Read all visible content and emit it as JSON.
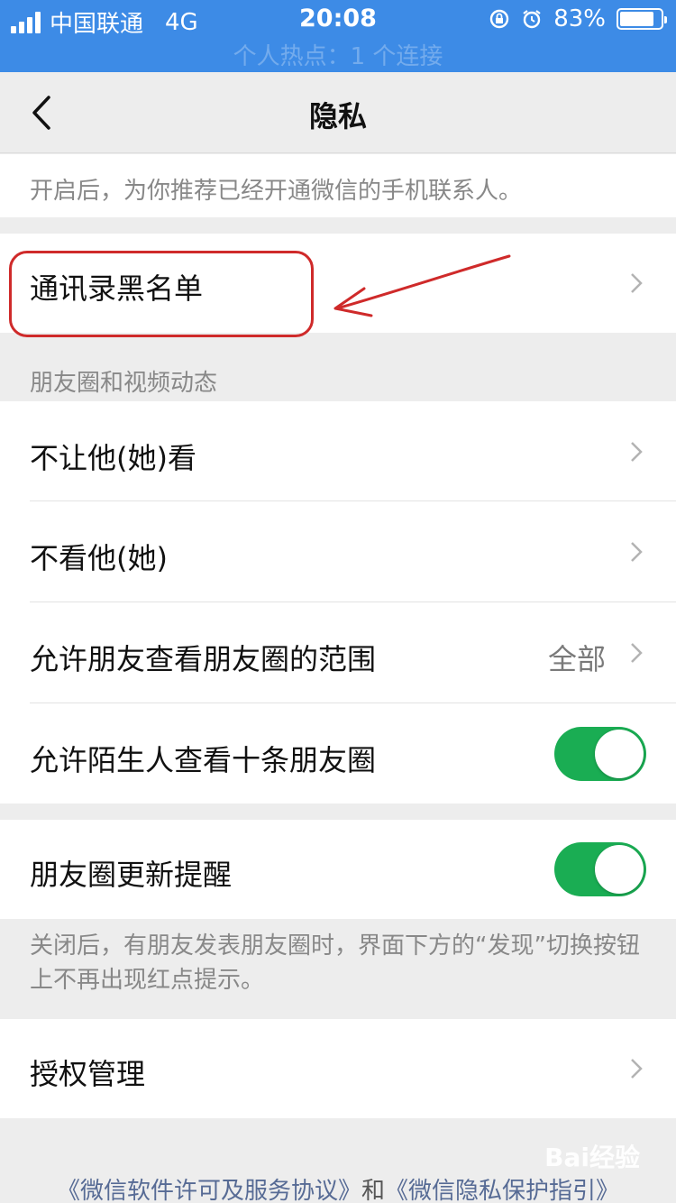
{
  "status_bar": {
    "carrier": "中国联通",
    "network": "4G",
    "time": "20:08",
    "battery": "83%",
    "battery_level": 0.83,
    "hotspot": "个人热点：1 个连接"
  },
  "nav": {
    "title": "隐私"
  },
  "top_desc": "开启后，为你推荐已经开通微信的手机联系人。",
  "blacklist": {
    "label": "通讯录黑名单"
  },
  "moments_section": {
    "header": "朋友圈和视频动态",
    "items": [
      {
        "label": "不让他(她)看"
      },
      {
        "label": "不看他(她)"
      },
      {
        "label": "允许朋友查看朋友圈的范围",
        "value": "全部"
      },
      {
        "label": "允许陌生人查看十条朋友圈",
        "toggle": true
      }
    ]
  },
  "update_reminder": {
    "label": "朋友圈更新提醒",
    "toggle": true,
    "desc": "关闭后，有朋友发表朋友圈时，界面下方的“发现”切换按钮上不再出现红点提示。"
  },
  "auth": {
    "label": "授权管理"
  },
  "footer": {
    "link1": "《微信软件许可及服务协议》",
    "and": "和",
    "link2": "《微信隐私保护指引》"
  },
  "watermark": "Bai经验",
  "colors": {
    "status_bar": "#3d8be6",
    "toggle_on": "#1aad53",
    "annotation": "#cf2a2a",
    "link": "#576b95"
  }
}
